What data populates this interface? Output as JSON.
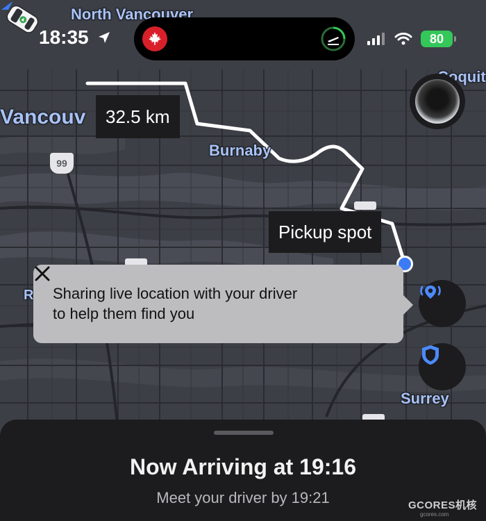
{
  "status_bar": {
    "time": "18:35",
    "battery": "80"
  },
  "map": {
    "labels": {
      "north_vancouver": "North Vancouver",
      "vancouver": "Vancouv",
      "burnaby": "Burnaby",
      "surrey": "Surrey",
      "coquitlam": "Coquitla",
      "r": "R"
    },
    "highway_badge": "99",
    "distance_tag": "32.5 km",
    "pickup_tag": "Pickup spot"
  },
  "tooltip": {
    "text": "Sharing live location with your driver\nto help them find you"
  },
  "sheet": {
    "title": "Now Arriving at 19:16",
    "subtitle": "Meet your driver by 19:21"
  },
  "watermark": {
    "brand": "GCORES机核",
    "url": "gcores.com"
  },
  "colors": {
    "map_background": "#3d3f47",
    "route": "#ffffff",
    "accent_blue": "#3b7bf6",
    "battery_green": "#34c759",
    "tooltip_background": "#bdbdbf",
    "sheet_background": "#1c1c1e"
  },
  "icons": {
    "location_arrow": "location-arrow-icon",
    "air_canada": "air-canada-maple-leaf-icon",
    "flight": "flight-departure-icon",
    "signal": "cellular-signal-icon",
    "wifi": "wifi-icon",
    "close": "close-icon",
    "share_location": "share-location-icon",
    "safety": "shield-icon"
  }
}
